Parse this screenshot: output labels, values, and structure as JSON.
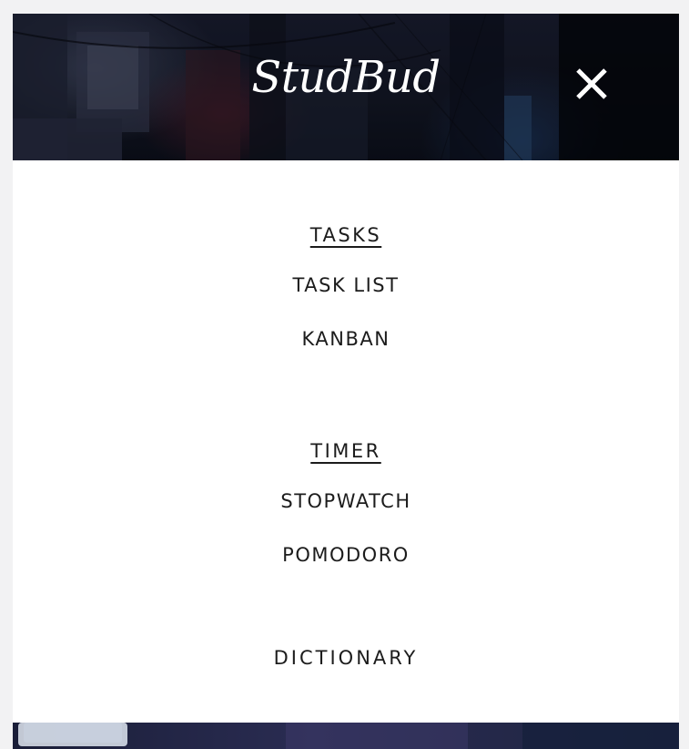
{
  "header": {
    "brand": "StudBud",
    "close_icon": "close-icon"
  },
  "menu": {
    "sections": [
      {
        "heading": "TASKS",
        "items": [
          "TASK LIST",
          "KANBAN"
        ]
      },
      {
        "heading": "TIMER",
        "items": [
          "STOPWATCH",
          "POMODORO"
        ]
      }
    ],
    "dictionary": "DICTIONARY"
  },
  "colors": {
    "text": "#1c1c1c",
    "brand_text": "#ffffff",
    "page_bg": "#f2f2f3",
    "menu_bg": "#ffffff"
  }
}
